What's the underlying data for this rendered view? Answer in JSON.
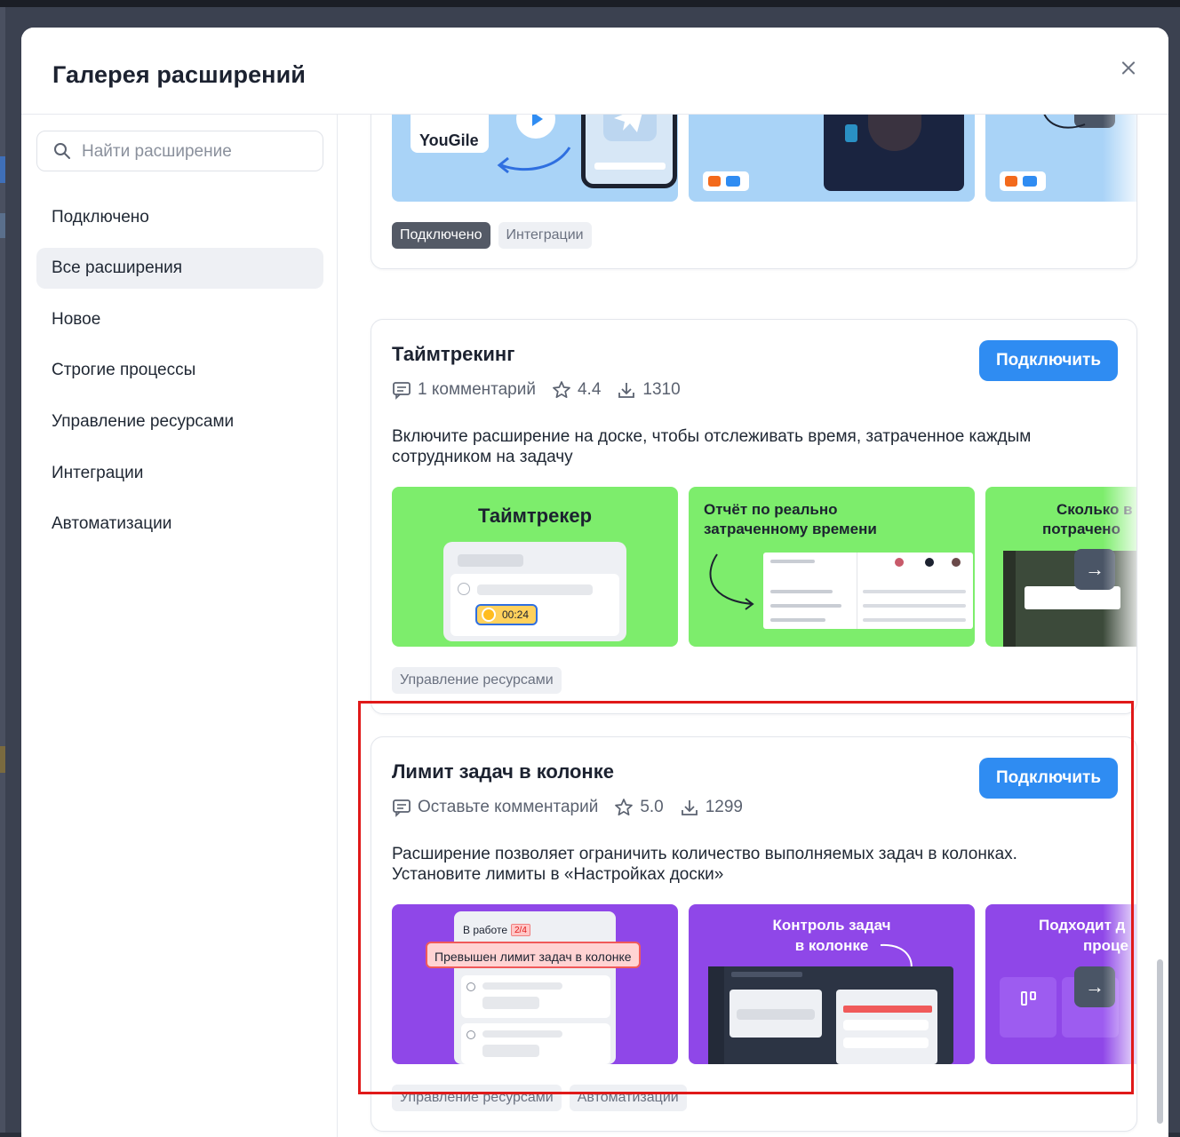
{
  "modal": {
    "title": "Галерея расширений"
  },
  "search": {
    "placeholder": "Найти расширение"
  },
  "sidebar": {
    "items": [
      {
        "label": "Подключено"
      },
      {
        "label": "Все расширения"
      },
      {
        "label": "Новое"
      },
      {
        "label": "Строгие процессы"
      },
      {
        "label": "Управление ресурсами"
      },
      {
        "label": "Интеграции"
      },
      {
        "label": "Автоматизации"
      }
    ],
    "active_index": 1
  },
  "cards": [
    {
      "shot_texts": {
        "logo": "YouGile"
      },
      "tags": [
        "Подключено",
        "Интеграции"
      ]
    },
    {
      "title": "Таймтрекинг",
      "button": "Подключить",
      "comments": "1 комментарий",
      "rating": "4.4",
      "downloads": "1310",
      "description": "Включите расширение на доске, чтобы отслеживать время, затраченное каждым сотрудником на задачу",
      "shot_texts": {
        "s1_title": "Таймтрекер",
        "s1_timer": "00:24",
        "s2_title_1": "Отчёт по реально",
        "s2_title_2": "затраченному времени",
        "s3_title_1": "Сколько в",
        "s3_title_2": "потрачено"
      },
      "tags": [
        "Управление ресурсами"
      ]
    },
    {
      "title": "Лимит задач в колонке",
      "button": "Подключить",
      "comments": "Оставьте комментарий",
      "rating": "5.0",
      "downloads": "1299",
      "description": "Расширение позволяет ограничить количество выполняемых задач в колонках. Установите лимиты в «Настройках доски»",
      "shot_texts": {
        "s1_column": "В работе",
        "s1_count": "2/4",
        "s1_warning": "Превышен лимит задач в колонке",
        "s2_title_1": "Контроль задач",
        "s2_title_2": "в колонке",
        "s3_title_1": "Подходит д",
        "s3_title_2": "проце"
      },
      "tags": [
        "Управление ресурсами",
        "Автоматизации"
      ]
    }
  ],
  "colors": {
    "accent": "#2f8cf2",
    "highlight": "#e01919",
    "green_shot": "#7ded6c",
    "purple_shot": "#8f47e8",
    "blue_shot": "#a9d3f7"
  },
  "icons": [
    "search-icon",
    "close-icon",
    "comment-icon",
    "star-icon",
    "download-icon",
    "arrow-right-icon",
    "telegram-icon",
    "play-icon"
  ]
}
